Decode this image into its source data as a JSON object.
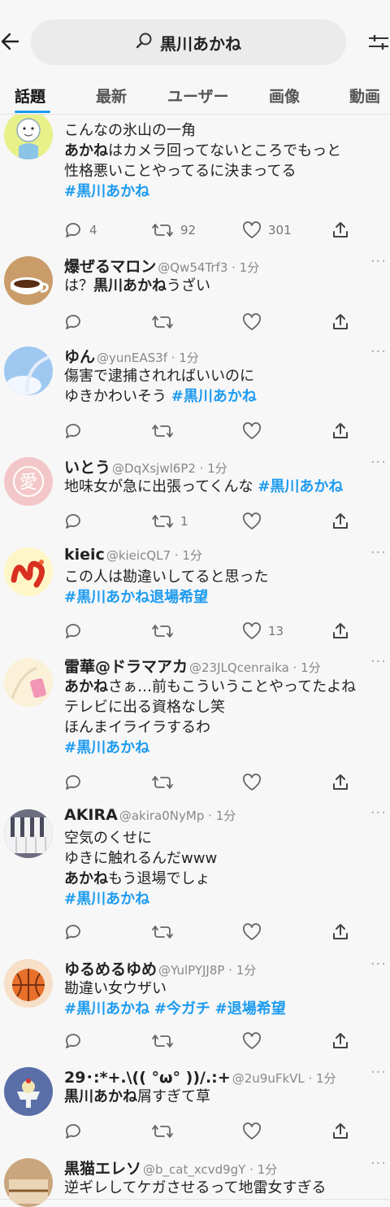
{
  "header": {
    "back_icon": "arrow-left-icon",
    "search_query": "黒川あかね",
    "filter_icon": "filter-sliders-icon"
  },
  "tabs": [
    {
      "label": "話題",
      "active": true
    },
    {
      "label": "最新"
    },
    {
      "label": "ユーザー"
    },
    {
      "label": "画像"
    },
    {
      "label": "動画"
    }
  ],
  "tweets": [
    {
      "name": "",
      "handle": "",
      "lines": [
        [
          {
            "t": "こんなの氷山の一角"
          }
        ],
        [
          {
            "t": "あかね",
            "b": true
          },
          {
            "t": "はカメラ回ってないところでもっと"
          }
        ],
        [
          {
            "t": "性格悪いことやってるに決まってる"
          }
        ],
        [
          {
            "t": "#黒川あかね",
            "tag": true
          }
        ]
      ],
      "reply": "4",
      "retweet": "92",
      "like": "301"
    },
    {
      "name": "爆ぜるマロン",
      "handle": "@Qw54Trf3 · 1分",
      "lines": [
        [
          {
            "t": "は？"
          },
          {
            "t": "黒川あかね",
            "b": true
          },
          {
            "t": "うざい"
          }
        ]
      ],
      "reply": "",
      "retweet": "",
      "like": ""
    },
    {
      "name": "ゆん",
      "handle": "@yunEAS3f · 1分",
      "lines": [
        [
          {
            "t": "傷害で逮捕されればいいのに"
          }
        ],
        [
          {
            "t": "ゆきかわいそう "
          },
          {
            "t": "#黒川あかね",
            "tag": true
          }
        ]
      ],
      "reply": "",
      "retweet": "",
      "like": ""
    },
    {
      "name": "いとう",
      "handle": "@DqXsjwl6P2 · 1分",
      "lines": [
        [
          {
            "t": "地味女が急に出張ってくんな "
          },
          {
            "t": "#黒川あかね",
            "tag": true
          }
        ]
      ],
      "reply": "",
      "retweet": "1",
      "like": ""
    },
    {
      "name": "kieic",
      "handle": "@kieicQL7 · 1分",
      "lines": [
        [
          {
            "t": "この人は勘違いしてると思った"
          }
        ],
        [
          {
            "t": "#黒川あかね退場希望",
            "tag": true
          }
        ]
      ],
      "reply": "",
      "retweet": "",
      "like": "13"
    },
    {
      "name": "雷華@ドラマアカ",
      "handle": "@23JLQcenraika · 1分",
      "lines": [
        [
          {
            "t": "あかね",
            "b": true
          },
          {
            "t": "さぁ…前もこういうことやってたよね"
          }
        ],
        [
          {
            "t": "テレビに出る資格なし笑"
          }
        ],
        [
          {
            "t": "ほんまイライラするわ"
          }
        ],
        [
          {
            "t": "#黒川あかね",
            "tag": true
          }
        ]
      ],
      "reply": "",
      "retweet": "",
      "like": ""
    },
    {
      "name": "AKIRA",
      "handle": "@akira0NyMp · 1分",
      "lines": [
        [
          {
            "t": "空気のくせに"
          }
        ],
        [
          {
            "t": "ゆきに触れるんだwww"
          }
        ],
        [
          {
            "t": "あかね",
            "b": true
          },
          {
            "t": "もう退場でしょ"
          }
        ],
        [
          {
            "t": "#黒川あかね",
            "tag": true
          }
        ]
      ],
      "reply": "",
      "retweet": "",
      "like": ""
    },
    {
      "name": "ゆるめるゆめ",
      "handle": "@YulPYJJ8P · 1分",
      "lines": [
        [
          {
            "t": "勘違い女ウザい"
          }
        ],
        [
          {
            "t": "#黒川あかね",
            "tag": true
          },
          {
            "t": " "
          },
          {
            "t": "#今ガチ",
            "tag": true
          },
          {
            "t": " "
          },
          {
            "t": "#退場希望",
            "tag": true
          }
        ]
      ],
      "reply": "",
      "retweet": "",
      "like": ""
    },
    {
      "name": "29･:*+.\\(( °ω° ))/.:+",
      "handle": "@2u9uFkVL · 1分",
      "lines": [
        [
          {
            "t": "黒川あかね",
            "b": true
          },
          {
            "t": "屑すぎて草"
          }
        ]
      ],
      "reply": "",
      "retweet": "",
      "like": ""
    },
    {
      "name": "黒猫エレソ",
      "handle": "@b_cat_xcvd9gY · 1分",
      "lines": [
        [
          {
            "t": "逆ギレしてケガさせるって地雷女すぎる"
          }
        ]
      ],
      "reply": "",
      "retweet": "",
      "like": ""
    }
  ],
  "icons": {
    "reply": "reply-bubble-icon",
    "retweet": "retweet-arrows-icon",
    "like": "heart-icon",
    "share": "share-upload-icon",
    "more": "more-dots-icon"
  }
}
